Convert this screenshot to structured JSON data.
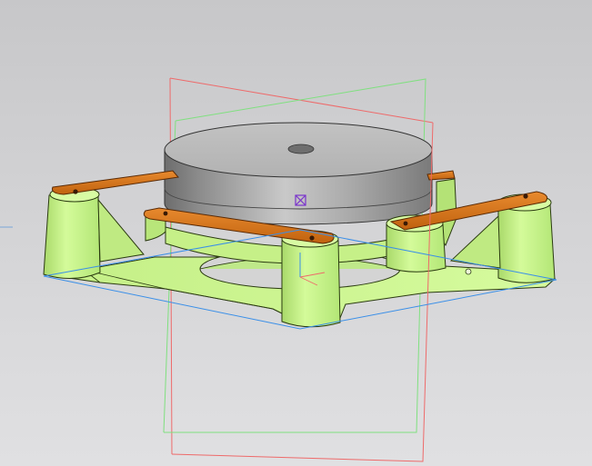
{
  "viewport": {
    "background_top": "#c7c7c9",
    "background_bottom": "#e0e0e2"
  },
  "model": {
    "platform_color": "#c8f58a",
    "platform_edge_color": "#2a3a10",
    "cylinder_color": "#9e9e9e",
    "arm_color": "#d9731a",
    "origin_marker_color": "#7a33cc",
    "icons": [
      "origin-marker-icon",
      "triad-axis-icon"
    ]
  },
  "planes": [
    {
      "name": "plane-red",
      "color": "#ee6a6a"
    },
    {
      "name": "plane-green",
      "color": "#7fe07f"
    },
    {
      "name": "plane-blue",
      "color": "#3a8fe8"
    }
  ]
}
